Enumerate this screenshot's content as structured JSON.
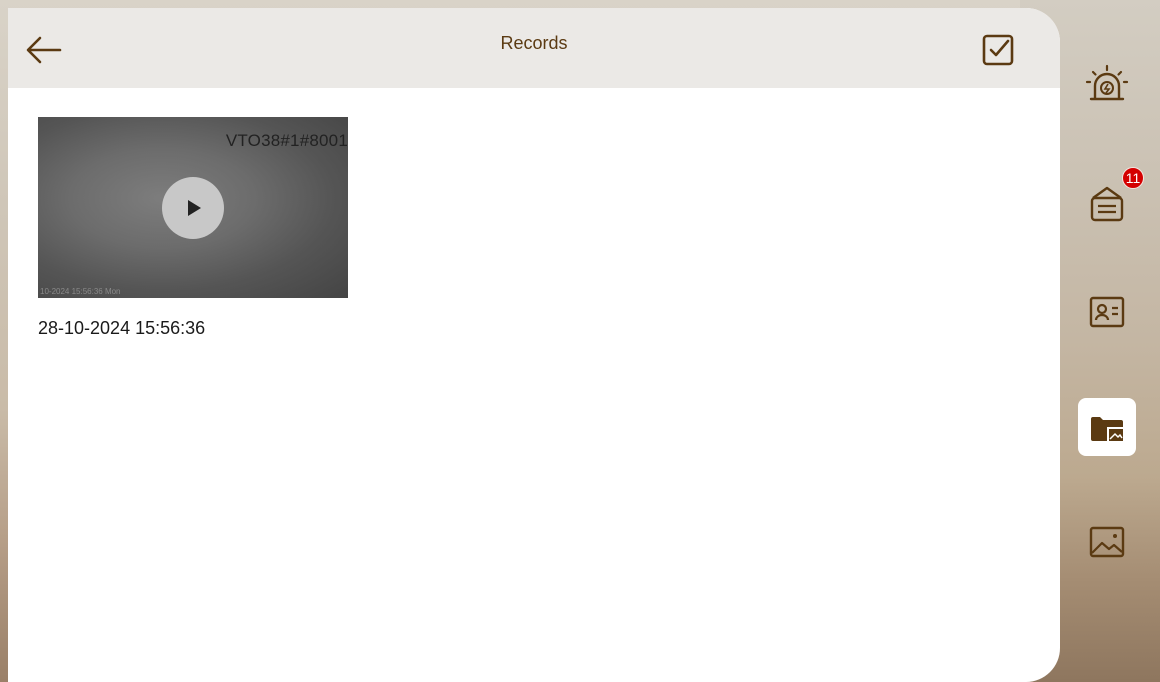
{
  "header": {
    "title": "Records",
    "back_icon": "arrow-left-icon",
    "select_icon": "checkbox-checked-icon"
  },
  "records": [
    {
      "camera": "VTO38#1#8001",
      "timestamp_overlay": "10-2024 15:56:36 Mon",
      "datetime": "28-10-2024 15:56:36"
    }
  ],
  "sidebar": {
    "items": [
      {
        "name": "alarm",
        "icon": "alarm-light-icon",
        "active": false
      },
      {
        "name": "messages",
        "icon": "notice-board-icon",
        "active": false,
        "badge": "11"
      },
      {
        "name": "contacts",
        "icon": "contact-card-icon",
        "active": false
      },
      {
        "name": "records",
        "icon": "video-records-icon",
        "active": true
      },
      {
        "name": "pictures",
        "icon": "picture-icon",
        "active": false
      }
    ]
  },
  "colors": {
    "accent": "#5b3a12",
    "header_bg": "#ebe9e6",
    "badge": "#d40000"
  }
}
